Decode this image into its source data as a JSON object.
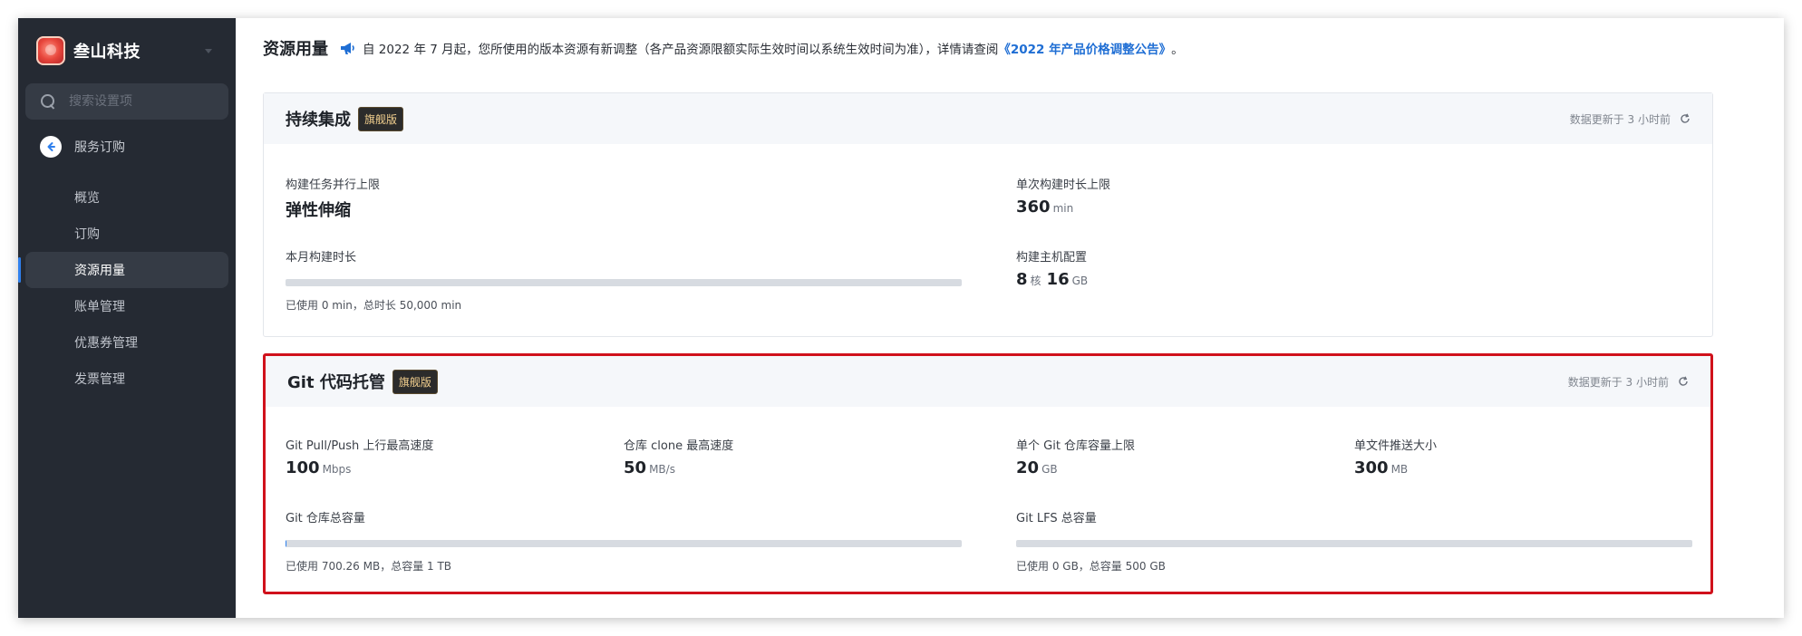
{
  "org": {
    "name": "叁山科技"
  },
  "search": {
    "placeholder": "搜索设置项"
  },
  "sidebar": {
    "back_label": "服务订购",
    "items": [
      {
        "label": "概览"
      },
      {
        "label": "订购"
      },
      {
        "label": "资源用量",
        "active": true
      },
      {
        "label": "账单管理"
      },
      {
        "label": "优惠券管理"
      },
      {
        "label": "发票管理"
      }
    ]
  },
  "header": {
    "title": "资源用量",
    "notice": "自 2022 年 7 月起，您所使用的版本资源有新调整（各产品资源限额实际生效时间以系统生效时间为准），详情请查阅",
    "notice_link": "《2022 年产品价格调整公告》",
    "notice_end": "。"
  },
  "ci": {
    "title": "持续集成",
    "badge": "旗舰版",
    "updated": "数据更新于 3 小时前",
    "concurrency_label": "构建任务并行上限",
    "concurrency_value": "弹性伸缩",
    "max_duration_label": "单次构建时长上限",
    "max_duration_value": "360",
    "max_duration_unit": "min",
    "monthly_label": "本月构建时长",
    "monthly_usage_fraction": 0,
    "monthly_note": "已使用 0 min，总时长 50,000 min",
    "host_label": "构建主机配置",
    "host_cpu": "8",
    "host_cpu_unit": "核",
    "host_mem": "16",
    "host_mem_unit": "GB"
  },
  "git": {
    "title": "Git 代码托管",
    "badge": "旗舰版",
    "updated": "数据更新于 3 小时前",
    "push_label": "Git Pull/Push 上行最高速度",
    "push_value": "100",
    "push_unit": "Mbps",
    "clone_label": "仓库 clone 最高速度",
    "clone_value": "50",
    "clone_unit": "MB/s",
    "repo_cap_label": "单个 Git 仓库容量上限",
    "repo_cap_value": "20",
    "repo_cap_unit": "GB",
    "file_push_label": "单文件推送大小",
    "file_push_value": "300",
    "file_push_unit": "MB",
    "total_label": "Git 仓库总容量",
    "total_usage_fraction": 0.0007,
    "total_note": "已使用 700.26 MB，总容量 1 TB",
    "lfs_label": "Git LFS 总容量",
    "lfs_usage_fraction": 0,
    "lfs_note": "已使用 0 GB，总容量 500 GB"
  },
  "colors": {
    "sidebar_bg": "#252a33",
    "accent": "#2f80ed",
    "highlight_border": "#d0111b",
    "badge_text": "#f2cf8e"
  }
}
